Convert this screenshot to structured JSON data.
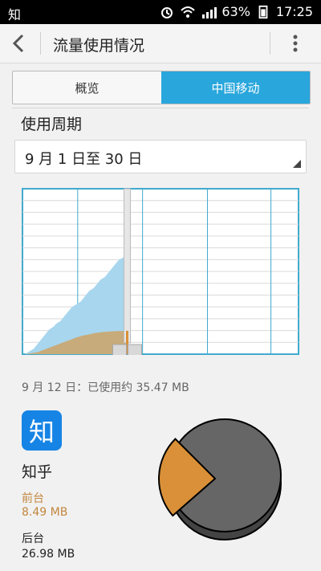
{
  "status_bar": {
    "left_app": "知",
    "battery": "63%",
    "time": "17:25",
    "icons": [
      "alarm-icon",
      "wifi-icon",
      "signal-icon",
      "battery-icon"
    ]
  },
  "app_bar": {
    "title": "流量使用情况",
    "icons": [
      "back-icon",
      "more-icon"
    ]
  },
  "tabs": [
    {
      "label": "概览",
      "active": false
    },
    {
      "label": "中国移动",
      "active": true
    }
  ],
  "cycle": {
    "title": "使用周期",
    "value": "9 月 1 日至 30 日"
  },
  "chart_data": {
    "type": "area",
    "series": [
      {
        "values": [
          0,
          0.5,
          1,
          1.5,
          2,
          3,
          4,
          5,
          6,
          7,
          8,
          9,
          9.5,
          10,
          11,
          11.5,
          12,
          13,
          14,
          15,
          16,
          17,
          17.5,
          18,
          18.5,
          19,
          20,
          21,
          22,
          23,
          23.5,
          24,
          25,
          26,
          27,
          27.5,
          28,
          29,
          30,
          31,
          32,
          33,
          34,
          34.5,
          35,
          35.3,
          35.47
        ]
      },
      {
        "values": [
          0,
          0.2,
          0.4,
          0.6,
          1,
          1.5,
          2,
          2.5,
          3,
          3.5,
          4,
          4.5,
          5,
          5.5,
          6,
          6.4,
          6.8,
          7,
          7.3,
          7.6,
          7.8,
          8,
          8.1,
          8.2,
          8.3,
          8.35,
          8.4,
          8.45,
          8.49
        ]
      }
    ],
    "colors": {
      "total": "#a8d6ee",
      "foreground": "#c8ab7a",
      "grid": "#d9d9d9",
      "frame": "#41aacf"
    },
    "marker_day": 12,
    "x_range": [
      1,
      30
    ],
    "y_range": [
      0,
      60
    ]
  },
  "usage": {
    "summary": "9 月 12 日：已使用约 35.47 MB"
  },
  "app": {
    "icon_text": "知",
    "name": "知乎",
    "foreground_label": "前台",
    "foreground_value": "8.49 MB",
    "background_label": "后台",
    "background_value": "26.98 MB"
  },
  "pie": {
    "foreground_mb": 8.49,
    "background_mb": 26.98,
    "colors": {
      "foreground": "#d99038",
      "background": "#666666"
    }
  }
}
